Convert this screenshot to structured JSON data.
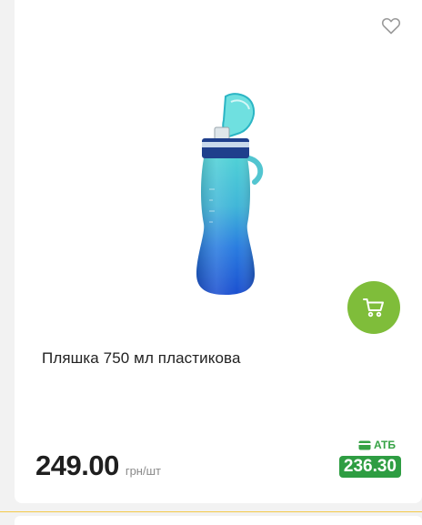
{
  "product": {
    "title": "Пляшка 750 мл пластикова",
    "price": "249.00",
    "unit": "грн/шт",
    "atb_label": "АТБ",
    "atb_price": "236.30"
  },
  "icons": {
    "favorite": "heart-outline-icon",
    "cart": "cart-icon",
    "card": "card-icon"
  },
  "colors": {
    "cart_button": "#7fbd3a",
    "atb_green": "#2e9d42",
    "divider": "#f3c94a"
  }
}
